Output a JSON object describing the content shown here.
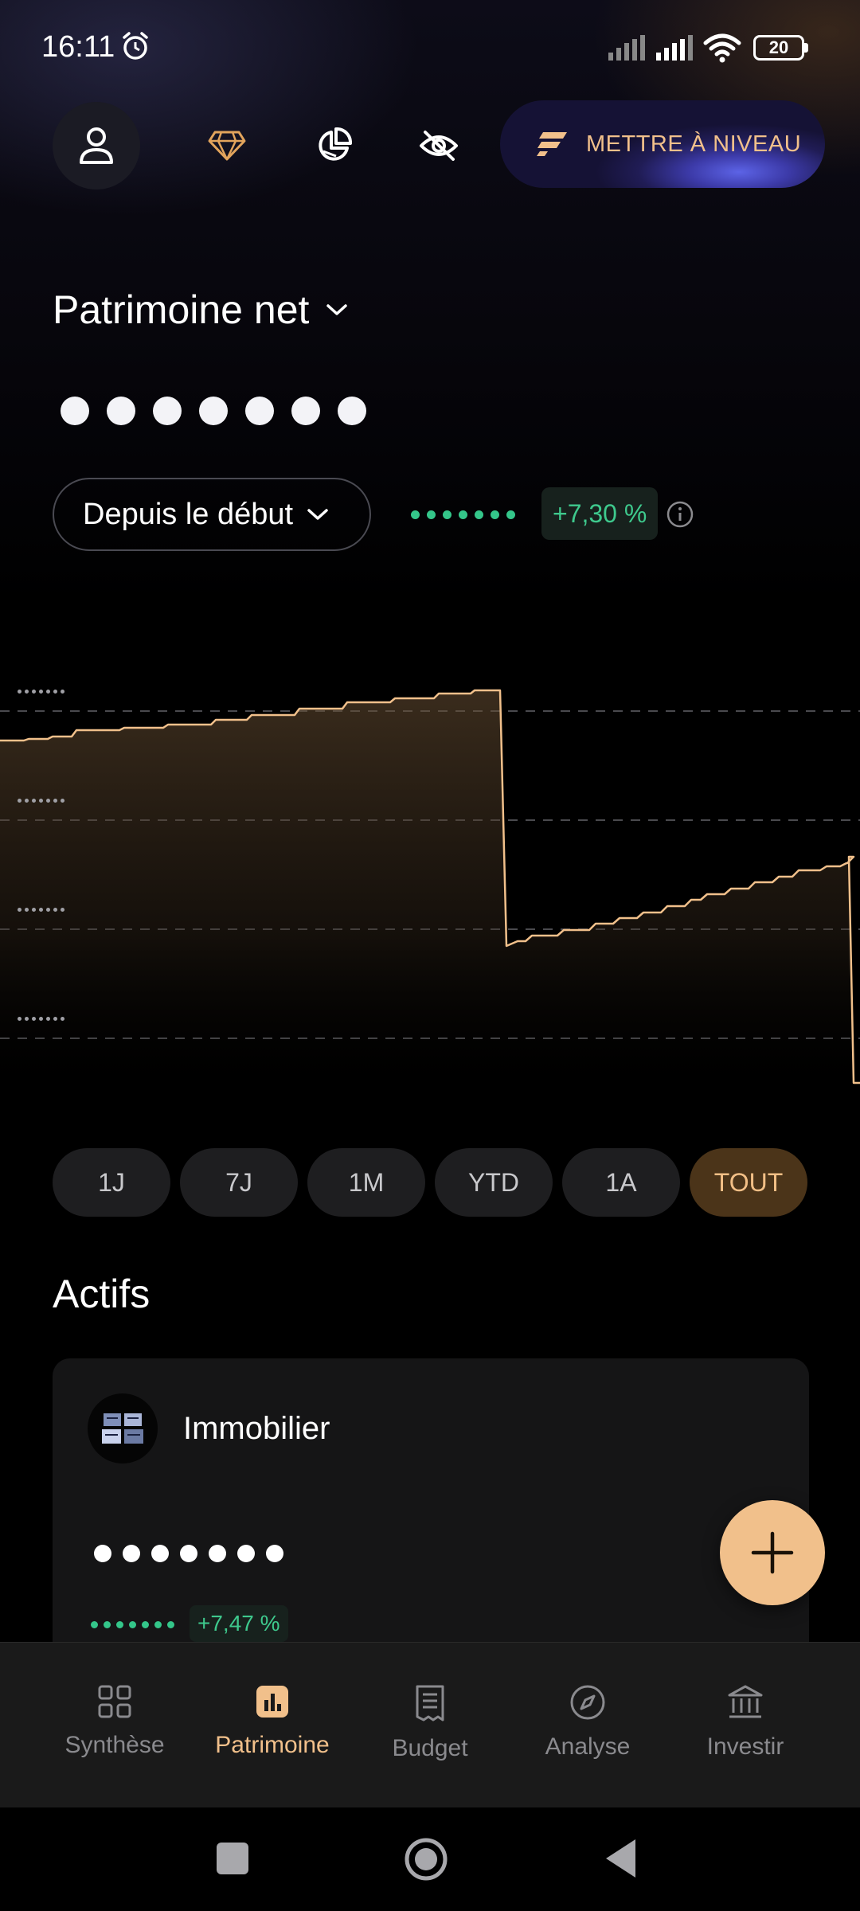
{
  "status_bar": {
    "time": "16:11",
    "battery": "20"
  },
  "header": {
    "upgrade_label": "METTRE À NIVEAU",
    "accent_color": "#f1c08b"
  },
  "net_worth": {
    "title": "Patrimoine net",
    "period_label": "Depuis le début",
    "performance": "+7,30 %"
  },
  "chart_data": {
    "type": "area",
    "note_hidden_values": true,
    "series": [
      {
        "color": "#f1c08b"
      }
    ]
  },
  "range_tabs": [
    {
      "label": "1J"
    },
    {
      "label": "7J"
    },
    {
      "label": "1M"
    },
    {
      "label": "YTD"
    },
    {
      "label": "1A"
    },
    {
      "label": "TOUT",
      "active": true
    }
  ],
  "assets": {
    "title": "Actifs",
    "items": [
      {
        "name": "Immobilier",
        "performance": "+7,47 %"
      }
    ]
  },
  "bottom_nav": [
    {
      "label": "Synthèse",
      "icon": "grid-icon"
    },
    {
      "label": "Patrimoine",
      "icon": "bar-chart-icon",
      "active": true
    },
    {
      "label": "Budget",
      "icon": "receipt-icon"
    },
    {
      "label": "Analyse",
      "icon": "compass-icon"
    },
    {
      "label": "Investir",
      "icon": "bank-icon"
    }
  ]
}
